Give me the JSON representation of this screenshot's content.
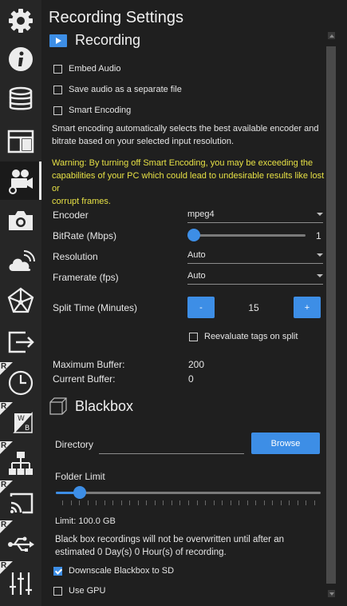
{
  "title": "Recording Settings",
  "recording": {
    "header": "Recording",
    "embed_audio": {
      "label": "Embed Audio",
      "checked": false
    },
    "separate_audio": {
      "label": "Save audio as a separate file",
      "checked": false
    },
    "smart_encoding": {
      "label": "Smart Encoding",
      "checked": false
    },
    "smart_desc_line1": "Smart encoding automatically selects the best available encoder and",
    "smart_desc_line2": "bitrate based on your selected input resolution.",
    "warning_line1": "Warning: By turning off Smart Encoding, you may be exceeding the",
    "warning_line2": "capabilities of your PC which could lead to undesirable results like lost or",
    "warning_line3": "corrupt frames.",
    "encoder": {
      "label": "Encoder",
      "value": "mpeg4"
    },
    "bitrate": {
      "label": "BitRate (Mbps)",
      "value": "1",
      "level": 0.0
    },
    "resolution": {
      "label": "Resolution",
      "value": "Auto"
    },
    "framerate": {
      "label": "Framerate (fps)",
      "value": "Auto"
    },
    "split_time": {
      "label": "Split Time (Minutes)",
      "minus": "-",
      "value": "15",
      "plus": "+"
    },
    "reevaluate": {
      "label": "Reevaluate tags on split",
      "checked": false
    },
    "max_buffer": {
      "label": "Maximum Buffer:",
      "value": "200"
    },
    "current_buffer": {
      "label": "Current Buffer:",
      "value": "0"
    }
  },
  "blackbox": {
    "header": "Blackbox",
    "directory": {
      "label": "Directory",
      "value": "",
      "browse": "Browse"
    },
    "folder_limit": {
      "label": "Folder Limit",
      "level": 0.07
    },
    "limit_text": "Limit:  100.0 GB",
    "note_line1": "Black box recordings will not be overwritten until after an",
    "note_line2": "estimated 0 Day(s) 0 Hour(s) of recording.",
    "downscale": {
      "label": "Downscale Blackbox to SD",
      "checked": true
    },
    "use_gpu": {
      "label": "Use GPU",
      "checked": false
    }
  },
  "sidebar": {
    "items": [
      {
        "icon": "gear-icon"
      },
      {
        "icon": "info-icon"
      },
      {
        "icon": "database-icon"
      },
      {
        "icon": "layout-icon"
      },
      {
        "icon": "video-camera-settings-icon",
        "active": true
      },
      {
        "icon": "camera-icon"
      },
      {
        "icon": "cloud-icon"
      },
      {
        "icon": "network-pentagon-icon"
      },
      {
        "icon": "export-icon"
      },
      {
        "icon": "clock-icon",
        "badge": "R"
      },
      {
        "icon": "white-balance-icon",
        "badge": "R"
      },
      {
        "icon": "network-icon",
        "badge": "R"
      },
      {
        "icon": "cast-icon",
        "badge": "R"
      },
      {
        "icon": "usb-icon",
        "badge": "R"
      },
      {
        "icon": "sliders-icon",
        "badge": "R"
      }
    ]
  },
  "colors": {
    "accent": "#3d8ee6",
    "warning": "#e6e045",
    "background": "#1f1f1f",
    "sidebar": "#262626"
  }
}
